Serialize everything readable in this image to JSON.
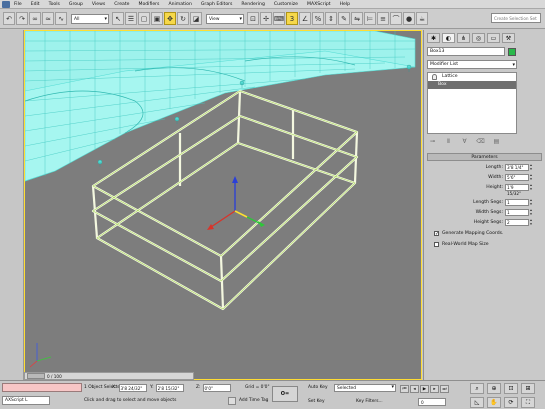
{
  "menu": [
    "File",
    "Edit",
    "Tools",
    "Group",
    "Views",
    "Create",
    "Modifiers",
    "Animation",
    "Graph Editors",
    "Rendering",
    "Customize",
    "MAXScript",
    "Help"
  ],
  "toolbar": {
    "filter_label": "All",
    "refcoord_label": "View",
    "search_placeholder": "Create Selection Set"
  },
  "viewport": {
    "label": ""
  },
  "timeslider": {
    "label": "0 / 100"
  },
  "command_panel": {
    "object_name": "Box13",
    "swatch_color": "#29b84a",
    "modifier_list_label": "Modifier List",
    "stack": [
      {
        "label": "Lattice",
        "selected": false
      },
      {
        "label": "Box",
        "selected": true
      }
    ],
    "rollout_title": "Parameters",
    "params": [
      {
        "label": "Length:",
        "value": "3'8 1/4\""
      },
      {
        "label": "Width:",
        "value": "5'6\""
      },
      {
        "label": "Height:",
        "value": "1'9 15/32\""
      }
    ],
    "segs": [
      {
        "label": "Length Segs:",
        "value": "1"
      },
      {
        "label": "Width Segs:",
        "value": "1"
      },
      {
        "label": "Height Segs:",
        "value": "2"
      }
    ],
    "checks": [
      {
        "label": "Generate Mapping Coords.",
        "checked": true
      },
      {
        "label": "Real-World Map Size",
        "checked": false
      }
    ]
  },
  "status": {
    "maxscript": "AXScript L",
    "selection_info": "1 Object Selected",
    "prompt": "Click and drag to select and move objects",
    "x_label": "X:",
    "x_value": "3'8 24/32\"",
    "y_label": "Y:",
    "y_value": "2'8 15/32\"",
    "z_label": "Z:",
    "z_value": "0'0\"",
    "grid": "Grid = 0'0\"",
    "add_time_tag": "Add Time Tag",
    "key_button": "O=",
    "auto_key": "Auto Key",
    "set_key": "Set Key",
    "selected_dd": "Selected",
    "key_filters": "Key Filters...",
    "frame": "0"
  }
}
